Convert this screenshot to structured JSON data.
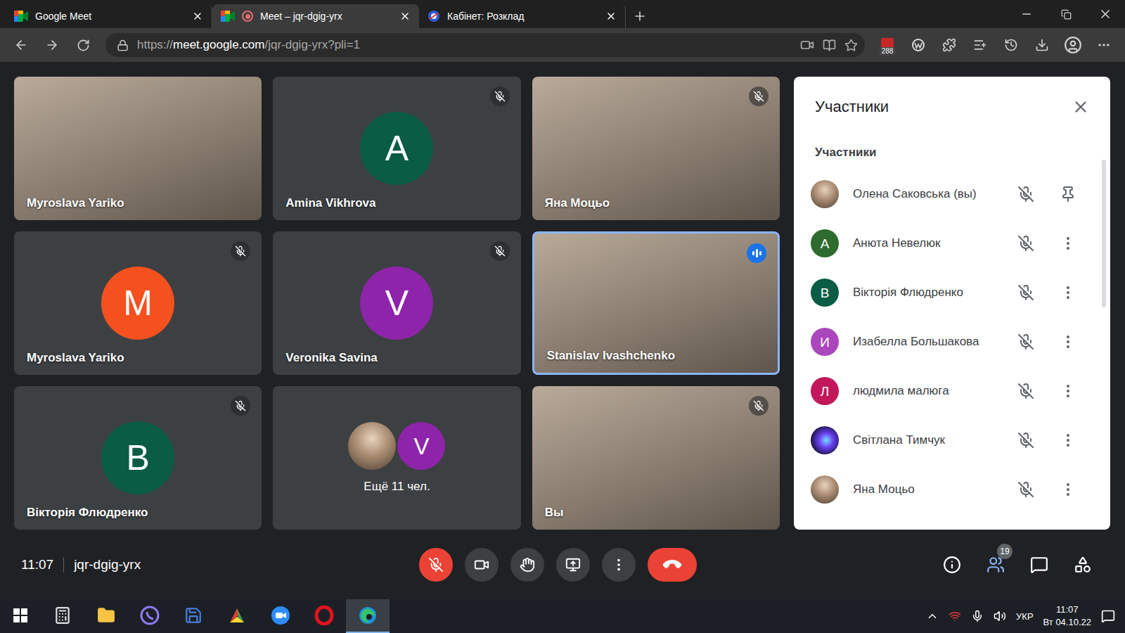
{
  "browser": {
    "tabs": [
      {
        "label": "Google Meet",
        "selected": false,
        "recording": false,
        "kind": "meet"
      },
      {
        "label": "Meet – jqr-dgig-yrx",
        "selected": true,
        "recording": true,
        "kind": "meet"
      },
      {
        "label": "Кабінет: Розклад",
        "selected": false,
        "recording": false,
        "kind": "site"
      }
    ],
    "url": {
      "scheme": "https://",
      "host": "meet.google.com",
      "path": "/jqr-dgig-yrx?pli=1"
    },
    "extension_badge": "288"
  },
  "tiles": [
    {
      "kind": "video",
      "name": "Myroslava Yariko",
      "muted": false,
      "speaking": false
    },
    {
      "kind": "avatar",
      "name": "Amina Vikhrova",
      "letter": "A",
      "color": "#0b5c45",
      "muted": true,
      "speaking": false
    },
    {
      "kind": "video",
      "name": "Яна Моцьо",
      "muted": true,
      "speaking": false
    },
    {
      "kind": "avatar",
      "name": "Myroslava Yariko",
      "letter": "M",
      "color": "#f4511e",
      "muted": true,
      "speaking": false
    },
    {
      "kind": "avatar",
      "name": "Veronika Savina",
      "letter": "V",
      "color": "#8e24aa",
      "muted": true,
      "speaking": false
    },
    {
      "kind": "video",
      "name": "Stanislav Ivashchenko",
      "muted": false,
      "speaking": true
    },
    {
      "kind": "avatar",
      "name": "Вікторія Флюдренко",
      "letter": "B",
      "color": "#0b5c45",
      "muted": true,
      "speaking": false
    },
    {
      "kind": "more",
      "label": "Ещё 11 чел.",
      "avatars": [
        {
          "kind": "photo"
        },
        {
          "kind": "letter",
          "letter": "V",
          "color": "#8e24aa"
        }
      ],
      "muted": false,
      "speaking": false
    },
    {
      "kind": "video",
      "name": "Вы",
      "muted": true,
      "speaking": false
    }
  ],
  "participants_panel": {
    "title": "Участники",
    "section": "Участники",
    "participants": [
      {
        "name": "Олена Саковська (вы)",
        "kind": "self",
        "avatar": {
          "kind": "photo"
        },
        "muted": true
      },
      {
        "name": "Анюта Невелюк",
        "kind": "other",
        "avatar": {
          "kind": "letter",
          "letter": "A",
          "color": "#2e6b2e"
        },
        "muted": true
      },
      {
        "name": "Вікторія Флюдренко",
        "kind": "other",
        "avatar": {
          "kind": "letter",
          "letter": "B",
          "color": "#0b5c45"
        },
        "muted": true
      },
      {
        "name": "Изабелла Большакова",
        "kind": "other",
        "avatar": {
          "kind": "letter",
          "letter": "И",
          "color": "#ab47bc"
        },
        "muted": true
      },
      {
        "name": "людмила малюга",
        "kind": "other",
        "avatar": {
          "kind": "letter",
          "letter": "Л",
          "color": "#c2185b"
        },
        "muted": true
      },
      {
        "name": "Світлана Тимчук",
        "kind": "other",
        "avatar": {
          "kind": "glow"
        },
        "muted": true
      },
      {
        "name": "Яна Моцьо",
        "kind": "other",
        "avatar": {
          "kind": "photo"
        },
        "muted": true
      }
    ]
  },
  "meeting_bar": {
    "time": "11:07",
    "code": "jqr-dgig-yrx",
    "mic_on": false,
    "camera_on": true,
    "people_count": "19",
    "people_open": true
  },
  "taskbar": {
    "apps": [
      {
        "kind": "calculator",
        "active": false
      },
      {
        "kind": "explorer",
        "active": false
      },
      {
        "kind": "viber",
        "active": false
      },
      {
        "kind": "save",
        "active": false
      },
      {
        "kind": "media",
        "active": false
      },
      {
        "kind": "zoom",
        "active": false
      },
      {
        "kind": "opera",
        "active": false
      },
      {
        "kind": "edge",
        "active": true
      }
    ],
    "language": "УКР",
    "time": "11:07",
    "date": "Вт 04.10.22"
  }
}
